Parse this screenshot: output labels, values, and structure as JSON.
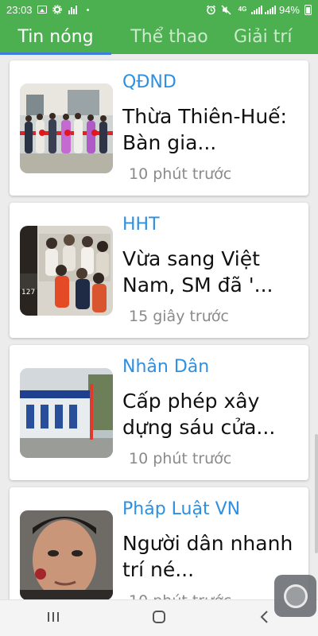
{
  "status_bar": {
    "time": "23:03",
    "network": "4G",
    "battery": "94%"
  },
  "tabs": [
    {
      "label": "Tin nóng",
      "active": true
    },
    {
      "label": "Thể thao",
      "active": false
    },
    {
      "label": "Giải trí",
      "active": false
    }
  ],
  "articles": [
    {
      "source": "QĐND",
      "title": "Thừa Thiên-Huế: Bàn gia...",
      "time": "10 phút trước"
    },
    {
      "source": "HHT",
      "title": "Vừa sang Việt Nam, SM đã '...",
      "time": "15 giây trước"
    },
    {
      "source": "Nhân Dân",
      "title": "Cấp phép xây dựng sáu cửa...",
      "time": "10 phút trước"
    },
    {
      "source": "Pháp Luật VN",
      "title": "Người dân nhanh trí né...",
      "time": "10 phút trước"
    }
  ],
  "colors": {
    "app_bar": "#4caf50",
    "tab_indicator": "#3f7de0",
    "source_text": "#2f8fe0",
    "title_text": "#111111",
    "time_text": "#8a8a8a"
  },
  "icons": {
    "status_left": [
      "gallery-icon",
      "settings-gear-icon",
      "signal-bars-icon",
      "dot-icon"
    ],
    "status_right": [
      "alarm-icon",
      "mute-icon",
      "wifi-icon",
      "signal-icon",
      "battery-icon"
    ],
    "nav": [
      "recents-icon",
      "home-icon",
      "back-icon"
    ]
  }
}
